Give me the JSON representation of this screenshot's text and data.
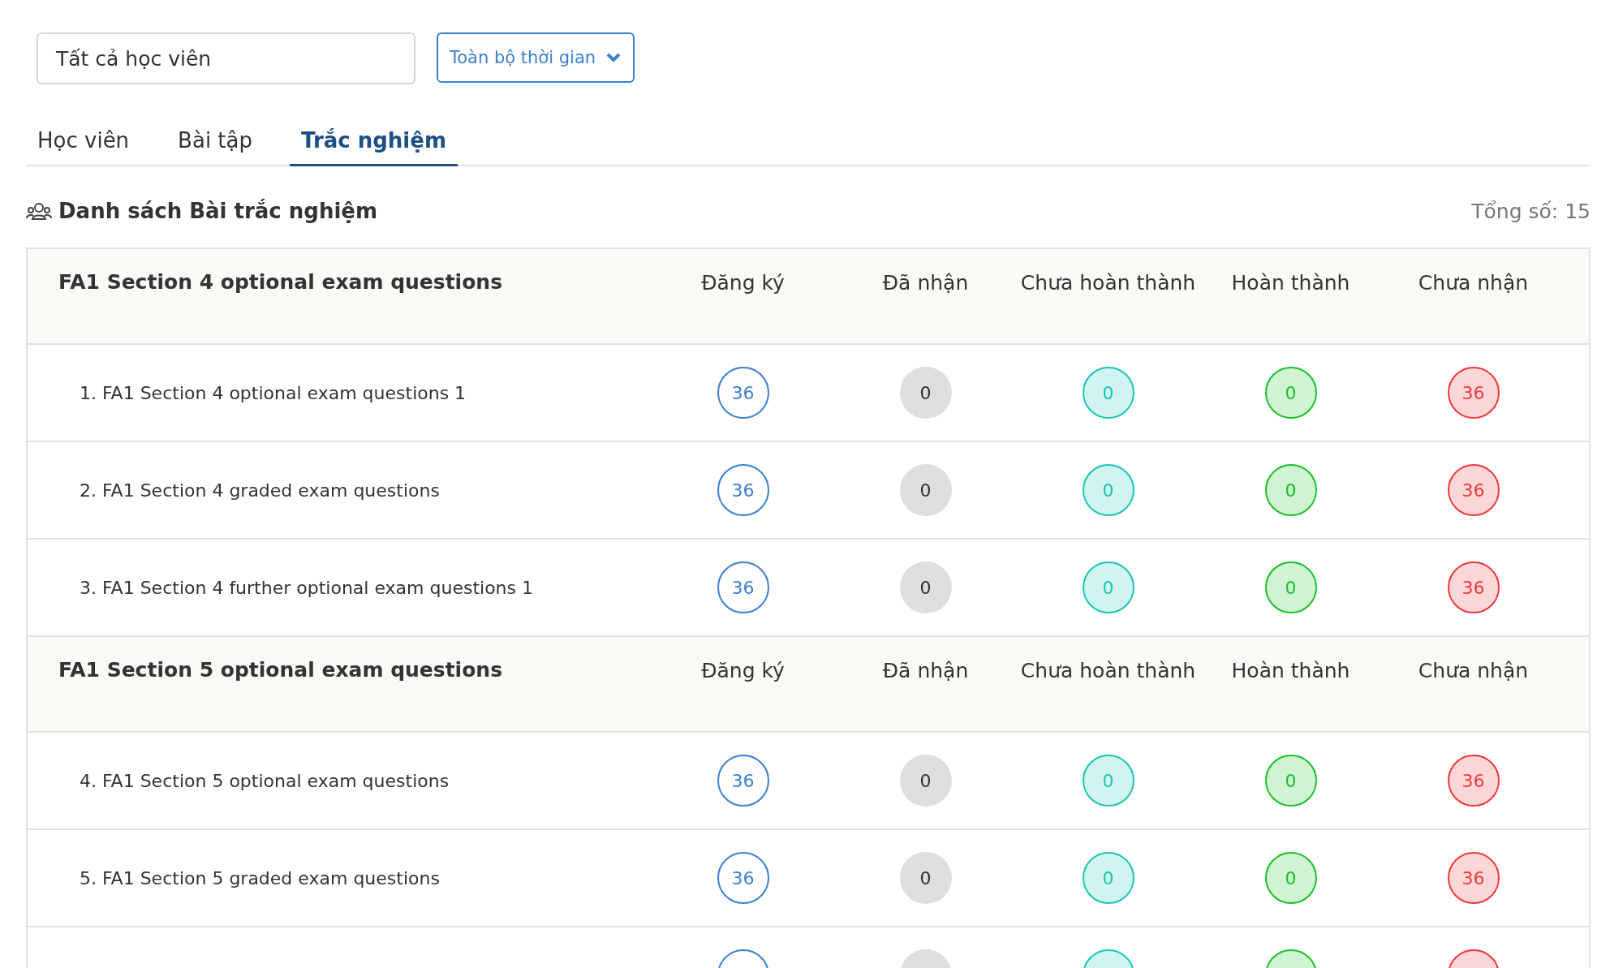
{
  "filters": {
    "student_select": {
      "value": "Tất cả học viên"
    },
    "period_dropdown": {
      "value": "Toàn bộ thời gian"
    }
  },
  "tabs": [
    {
      "label": "Học viên",
      "selected": false
    },
    {
      "label": "Bài tập",
      "selected": false
    },
    {
      "label": "Trắc nghiệm",
      "selected": true
    }
  ],
  "section": {
    "title": "Danh sách Bài trắc nghiệm",
    "total": "Tổng số: 15"
  },
  "columns": [
    {
      "kind": "outline",
      "color": "#3b7fd0"
    },
    {
      "kind": "muted",
      "color": "#333333"
    },
    {
      "kind": "tinted",
      "color": "#18c6b4"
    },
    {
      "kind": "tinted",
      "color": "#17c22a"
    },
    {
      "kind": "tinted",
      "color": "#f0383c"
    }
  ],
  "groups": [
    {
      "title": "FA1 Section 4 optional exam questions",
      "headers": [
        "Đăng ký",
        "Đã nhận",
        "Chưa hoàn thành",
        "Hoàn thành",
        "Chưa nhận"
      ],
      "rows": [
        {
          "name": "1. FA1 Section 4 optional exam questions 1",
          "counts": [
            "36",
            "0",
            "0",
            "0",
            "36"
          ]
        },
        {
          "name": "2. FA1 Section 4 graded exam questions",
          "counts": [
            "36",
            "0",
            "0",
            "0",
            "36"
          ]
        },
        {
          "name": "3. FA1 Section 4 further optional exam questions 1",
          "counts": [
            "36",
            "0",
            "0",
            "0",
            "36"
          ]
        }
      ]
    },
    {
      "title": "FA1 Section 5 optional exam questions",
      "headers": [
        "Đăng ký",
        "Đã nhận",
        "Chưa hoàn thành",
        "Hoàn thành",
        "Chưa nhận"
      ],
      "rows": [
        {
          "name": "4. FA1 Section 5 optional exam questions",
          "counts": [
            "36",
            "0",
            "0",
            "0",
            "36"
          ]
        },
        {
          "name": "5. FA1 Section 5 graded exam questions",
          "counts": [
            "36",
            "0",
            "0",
            "0",
            "36"
          ]
        },
        {
          "counts": []
        }
      ]
    }
  ]
}
